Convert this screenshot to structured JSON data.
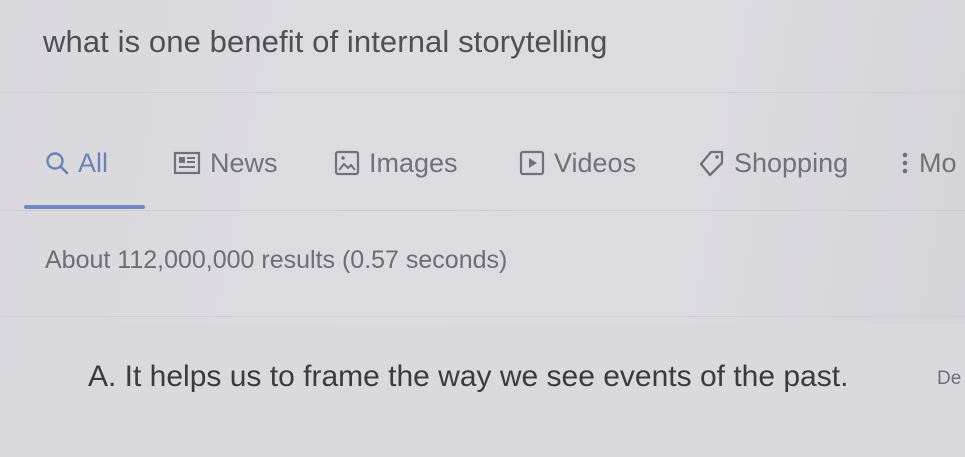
{
  "search": {
    "query": "what is one benefit of internal storytelling"
  },
  "tabs": [
    {
      "label": "All",
      "icon": "search-icon",
      "active": true
    },
    {
      "label": "News",
      "icon": "news-icon",
      "active": false
    },
    {
      "label": "Images",
      "icon": "image-icon",
      "active": false
    },
    {
      "label": "Videos",
      "icon": "play-icon",
      "active": false
    },
    {
      "label": "Shopping",
      "icon": "tag-icon",
      "active": false
    },
    {
      "label": "Mo",
      "icon": "more-vertical-icon",
      "active": false
    }
  ],
  "results": {
    "stats": "About 112,000,000 results (0.57 seconds)"
  },
  "answer": {
    "text": "A. It helps us to frame the way we see events of the past.",
    "truncated_link": "De"
  },
  "colors": {
    "accent": "#7089c0",
    "text_primary": "#3b3b3f",
    "text_secondary": "#707277",
    "background": "#dcdbe0"
  }
}
